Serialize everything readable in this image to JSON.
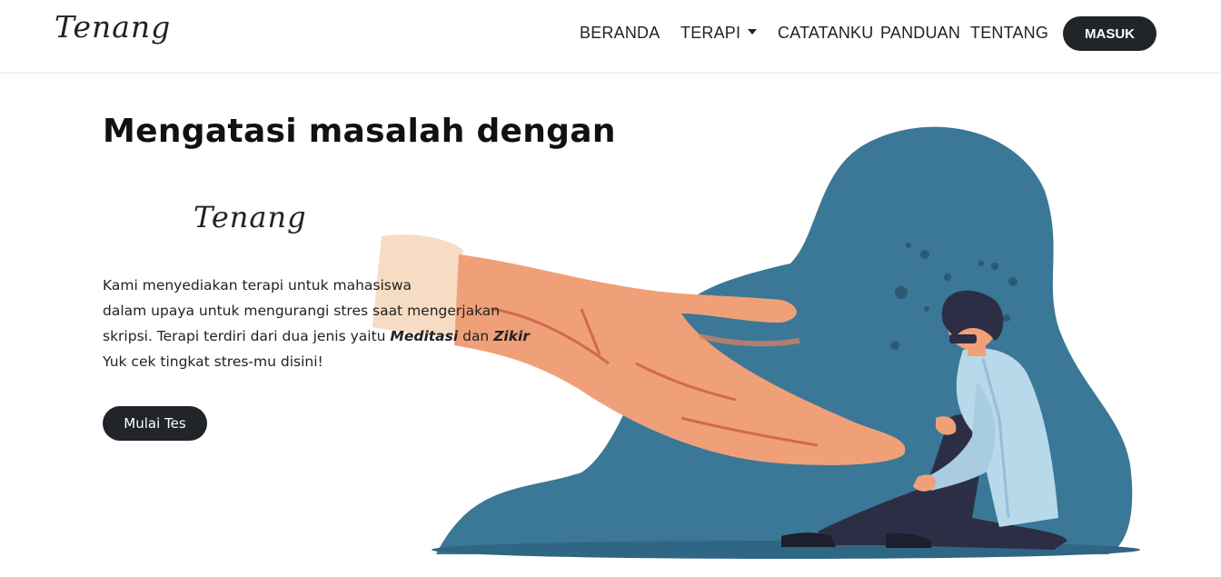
{
  "navbar": {
    "brand": "Tenang",
    "links": {
      "beranda": "BERANDA",
      "terapi": "TERAPI",
      "catatanku": "CATATANKU",
      "panduan": "PANDUAN",
      "tentang": "TENTANG"
    },
    "login_label": "MASUK"
  },
  "hero": {
    "title": "Mengatasi masalah dengan",
    "brand": "Tenang",
    "description": {
      "line1": "Kami menyediakan terapi untuk mahasiswa",
      "line2": "dalam upaya untuk mengurangi stres saat mengerjakan",
      "line3_prefix": "skripsi. Terapi terdiri dari dua jenis yaitu ",
      "meditasi": "Meditasi",
      "connector": " dan ",
      "zikir": "Zikir",
      "line4": "Yuk cek tingkat stres-mu disini!"
    },
    "cta_label": "Mulai Tes"
  },
  "colors": {
    "dark_button": "#212529",
    "blob_blue": "#3b7796",
    "skin": "#f0a078",
    "shirt": "#b8d9ea",
    "pants": "#2c2e45"
  },
  "icons": {
    "dropdown": "caret-down-icon",
    "illustration": "helping-hand-illustration"
  }
}
